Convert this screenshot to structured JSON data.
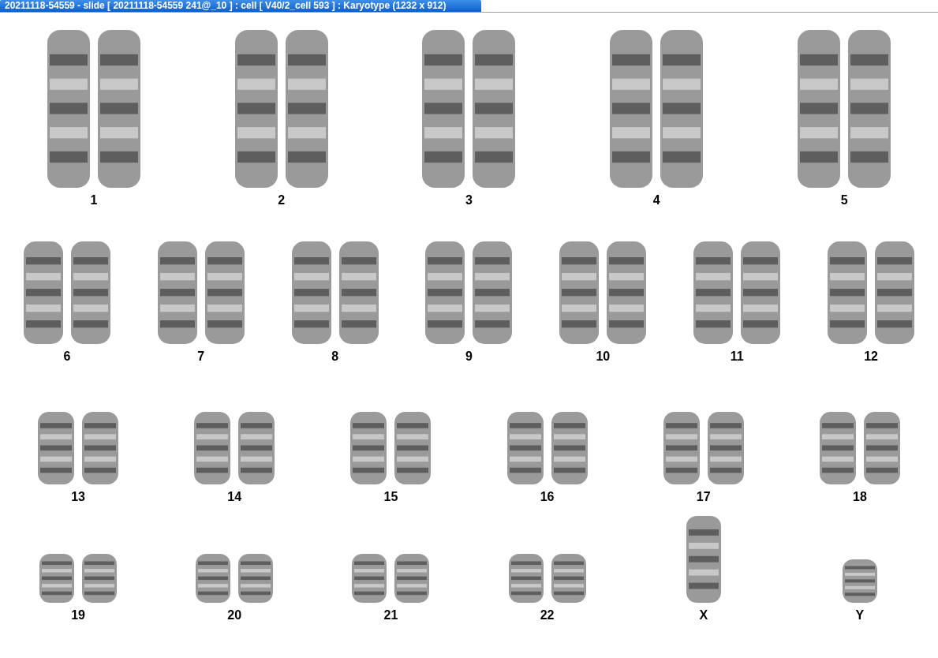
{
  "window": {
    "title": "20211118-54559 - slide [ 20211118-54559 241@_10 ] : cell [ V40/2_cell 593 ] : Karyotype  (1232 x 912)"
  },
  "rows": [
    {
      "chromosomes": [
        {
          "label": "1",
          "kind": "pair"
        },
        {
          "label": "2",
          "kind": "pair"
        },
        {
          "label": "3",
          "kind": "pair"
        },
        {
          "label": "4",
          "kind": "pair"
        },
        {
          "label": "5",
          "kind": "pair"
        }
      ]
    },
    {
      "chromosomes": [
        {
          "label": "6",
          "kind": "pair"
        },
        {
          "label": "7",
          "kind": "pair"
        },
        {
          "label": "8",
          "kind": "pair"
        },
        {
          "label": "9",
          "kind": "pair"
        },
        {
          "label": "10",
          "kind": "pair"
        },
        {
          "label": "11",
          "kind": "pair"
        },
        {
          "label": "12",
          "kind": "pair"
        }
      ]
    },
    {
      "chromosomes": [
        {
          "label": "13",
          "kind": "pair"
        },
        {
          "label": "14",
          "kind": "pair"
        },
        {
          "label": "15",
          "kind": "pair"
        },
        {
          "label": "16",
          "kind": "pair"
        },
        {
          "label": "17",
          "kind": "pair"
        },
        {
          "label": "18",
          "kind": "pair"
        }
      ]
    },
    {
      "chromosomes": [
        {
          "label": "19",
          "kind": "pair"
        },
        {
          "label": "20",
          "kind": "pair"
        },
        {
          "label": "21",
          "kind": "pair"
        },
        {
          "label": "22",
          "kind": "pair"
        },
        {
          "label": "X",
          "kind": "single"
        },
        {
          "label": "Y",
          "kind": "single"
        }
      ]
    }
  ]
}
